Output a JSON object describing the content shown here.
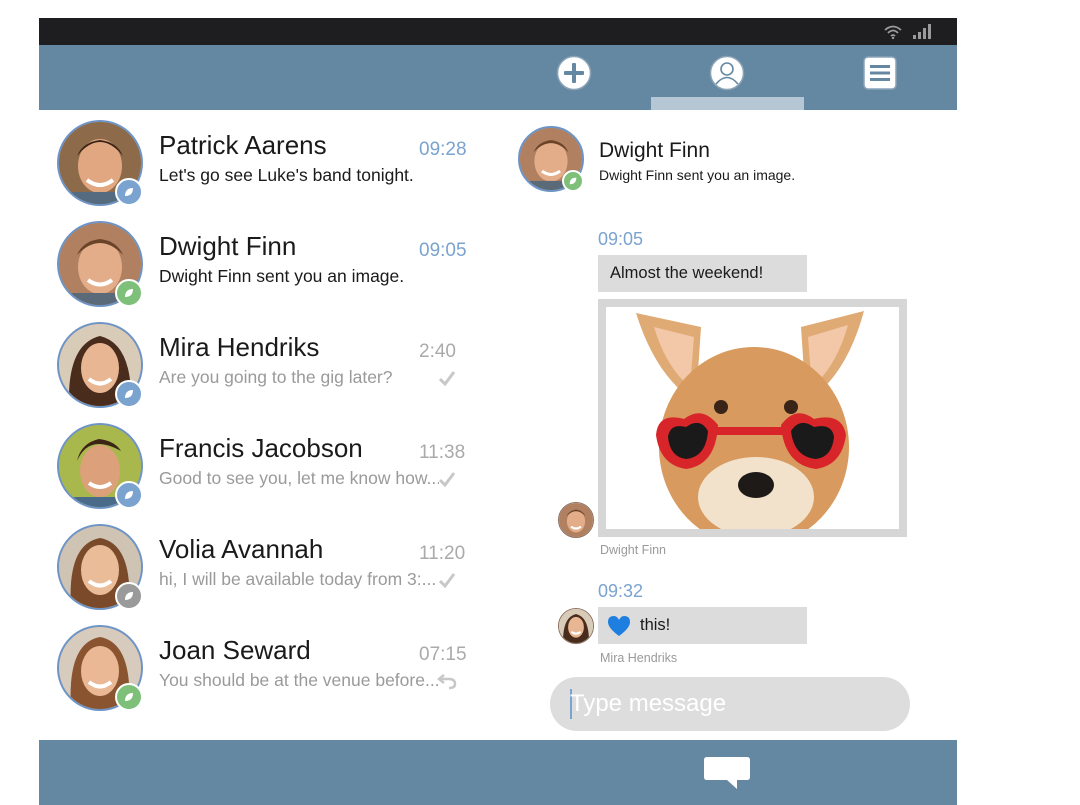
{
  "colors": {
    "bar": "#6588a2",
    "status_bar": "#1e1e20",
    "accent_time": "#7aa3cf",
    "badge_blue": "#7aa3cf",
    "badge_green": "#7ec07a",
    "badge_gray": "#9a9a9a",
    "bubble": "#dcdcdc"
  },
  "status_bar": {
    "icons": [
      "wifi-icon",
      "signal-icon"
    ]
  },
  "top_bar": {
    "buttons": [
      {
        "name": "new-chat",
        "icon": "plus-circle-icon"
      },
      {
        "name": "contacts-tab",
        "icon": "profile-icon",
        "active": true
      },
      {
        "name": "menu",
        "icon": "menu-icon"
      }
    ]
  },
  "conversations": [
    {
      "name": "Patrick Aarens",
      "time": "09:28",
      "preview": "Let's go see Luke's band tonight.",
      "unread": true,
      "badge": "blue",
      "status_icon": ""
    },
    {
      "name": "Dwight Finn",
      "time": "09:05",
      "preview": "Dwight Finn sent you an image.",
      "unread": true,
      "badge": "green",
      "status_icon": ""
    },
    {
      "name": "Mira Hendriks",
      "time": "2:40",
      "preview": "Are you going to the gig later?",
      "unread": false,
      "badge": "blue",
      "status_icon": "check-icon"
    },
    {
      "name": "Francis Jacobson",
      "time": "11:38",
      "preview": "Good to see you, let me know how...",
      "unread": false,
      "badge": "blue",
      "status_icon": "check-icon"
    },
    {
      "name": "Volia Avannah",
      "time": "11:20",
      "preview": "hi, I will be available today from 3:...",
      "unread": false,
      "badge": "gray",
      "status_icon": "check-icon"
    },
    {
      "name": "Joan Seward",
      "time": "07:15",
      "preview": "You should be at the venue before...",
      "unread": false,
      "badge": "green",
      "status_icon": "reply-icon"
    }
  ],
  "chat": {
    "header": {
      "name": "Dwight Finn",
      "subtitle": "Dwight Finn sent you an image."
    },
    "messages": [
      {
        "time": "09:05",
        "text": "Almost the weekend!",
        "has_image": true,
        "image_desc": "dog-photo",
        "sender": "Dwight Finn"
      },
      {
        "time": "09:32",
        "text": "this!",
        "icon": "heart-icon",
        "sender": "Mira Hendriks"
      }
    ],
    "input": {
      "placeholder": "Type message",
      "value": ""
    }
  },
  "bottom_bar": {
    "button_icon": "chat-bubble-icon"
  }
}
